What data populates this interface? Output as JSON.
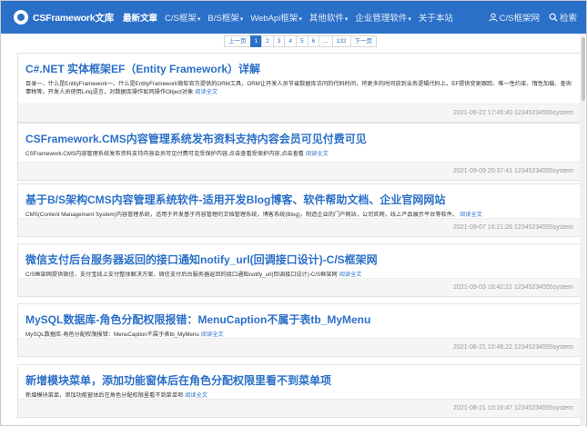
{
  "nav": {
    "brand": "CSFramework文库",
    "items": [
      {
        "label": "最新文章",
        "active": true,
        "caret": false
      },
      {
        "label": "C/S框架",
        "active": false,
        "caret": true
      },
      {
        "label": "B/S框架",
        "active": false,
        "caret": true
      },
      {
        "label": "WebApi框架",
        "active": false,
        "caret": true
      },
      {
        "label": "其他软件",
        "active": false,
        "caret": true
      },
      {
        "label": "企业管理软件",
        "active": false,
        "caret": true
      },
      {
        "label": "关于本站",
        "active": false,
        "caret": false
      }
    ],
    "user": "C/S框架网",
    "search": "检索",
    "caret_glyph": "▾"
  },
  "pager": {
    "prev": "上一页",
    "pages": [
      "1",
      "2",
      "3",
      "4",
      "5",
      "6",
      "...",
      "132"
    ],
    "next": "下一页",
    "active": "1"
  },
  "articles": [
    {
      "title": "C#.NET 实体框架EF（Entity Framework）详解",
      "summary": "目录一、什么是EntityFramework一、什么是EntityFramework微软官方提供的ORM工具，ORM让开发人员节省数据库访问的代码时间，将更多的时间放到业务逻辑代码上。EF提供变更跟踪、唯一性约束、惰性加载、查询事物等。开发人员使用Linq语言，对数据库操作如同操作Object对象",
      "readmore": "阅读全文",
      "date": "2021-09-22 17:45:40",
      "author": "12345234555system"
    },
    {
      "title": "CSFramework.CMS内容管理系统发布资料支持内容会员可见付费可见",
      "summary": "CSFramework.CMS内容管理系统发布资料支持内容会员可见付费可见受保护内容,点击查看受保护内容,点击查看",
      "readmore": "阅读全文",
      "date": "2021-09-09 20:37:41",
      "author": "12345234555system"
    },
    {
      "title": "基于B/S架构CMS内容管理系统软件-适用开发Blog博客、软件帮助文档、企业官网网站",
      "summary": "CMS(Content Management System)内容管理系统，适用于开发基于内容管理的文档管理系统，博客系统(Blog)，制造企业的门户网站，公司官网，线上产品展示平台等软件。",
      "readmore": "阅读全文",
      "date": "2021-09-07 16:21:26",
      "author": "12345234555system"
    },
    {
      "title": "微信支付后台服务器返回的接口通知notify_url(回调接口设计)-C/S框架网",
      "summary": "C/S框架网提供微信，支付宝线上支付整体解决方案，微信支付后台服务器返回的接口通知notify_url(回调接口设计)-C/S框架网",
      "readmore": "阅读全文",
      "date": "2021-09-03 16:42:21",
      "author": "12345234555system"
    },
    {
      "title": "MySQL数据库-角色分配权限报错：MenuCaption不属于表tb_MyMenu",
      "summary": "MySQL数据库-角色分配权限报错：MenuCaption不属于表tb_MyMenu",
      "readmore": "阅读全文",
      "date": "2021-08-21 10:49:22",
      "author": "12345234555system"
    },
    {
      "title": "新增模块菜单，添加功能窗体后在角色分配权限里看不到菜单项",
      "summary": "新增模块菜单，添加功能窗体后在角色分配权限里看不到菜单项",
      "readmore": "阅读全文",
      "date": "2021-08-21 10:16:47",
      "author": "12345234555system"
    }
  ]
}
